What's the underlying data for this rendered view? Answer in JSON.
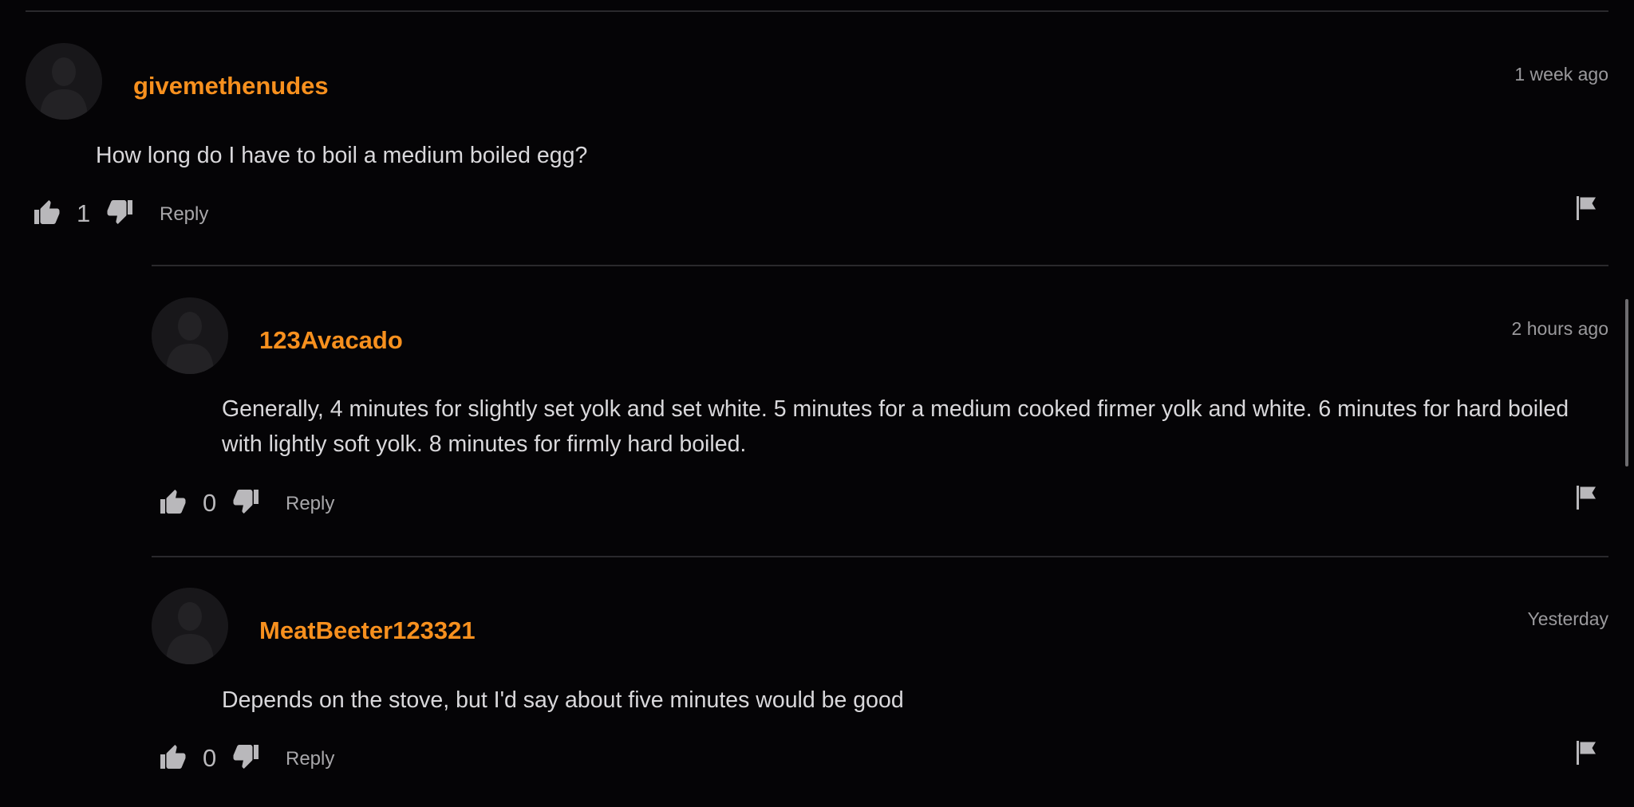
{
  "colors": {
    "background": "#050406",
    "username": "#f7901e",
    "body_text": "#d9d8db",
    "meta_text": "#9a999c",
    "divider": "#2a292c"
  },
  "icons": {
    "avatar": "avatar-placeholder-icon",
    "upvote": "thumbs-up-icon",
    "downvote": "thumbs-down-icon",
    "report": "flag-icon"
  },
  "comments": [
    {
      "username": "givemethenudes",
      "timestamp": "1 week ago",
      "body": "How long do I have to boil a medium boiled egg?",
      "votes": "1",
      "reply_label": "Reply"
    },
    {
      "username": "123Avacado",
      "timestamp": "2 hours ago",
      "body": "Generally, 4 minutes for slightly set yolk and set white. 5 minutes for a medium cooked firmer yolk and white. 6 minutes for hard boiled with lightly soft yolk. 8 minutes for firmly hard boiled.",
      "votes": "0",
      "reply_label": "Reply"
    },
    {
      "username": "MeatBeeter123321",
      "timestamp": "Yesterday",
      "body": "Depends on the stove, but I'd say about five minutes would be good",
      "votes": "0",
      "reply_label": "Reply"
    }
  ]
}
